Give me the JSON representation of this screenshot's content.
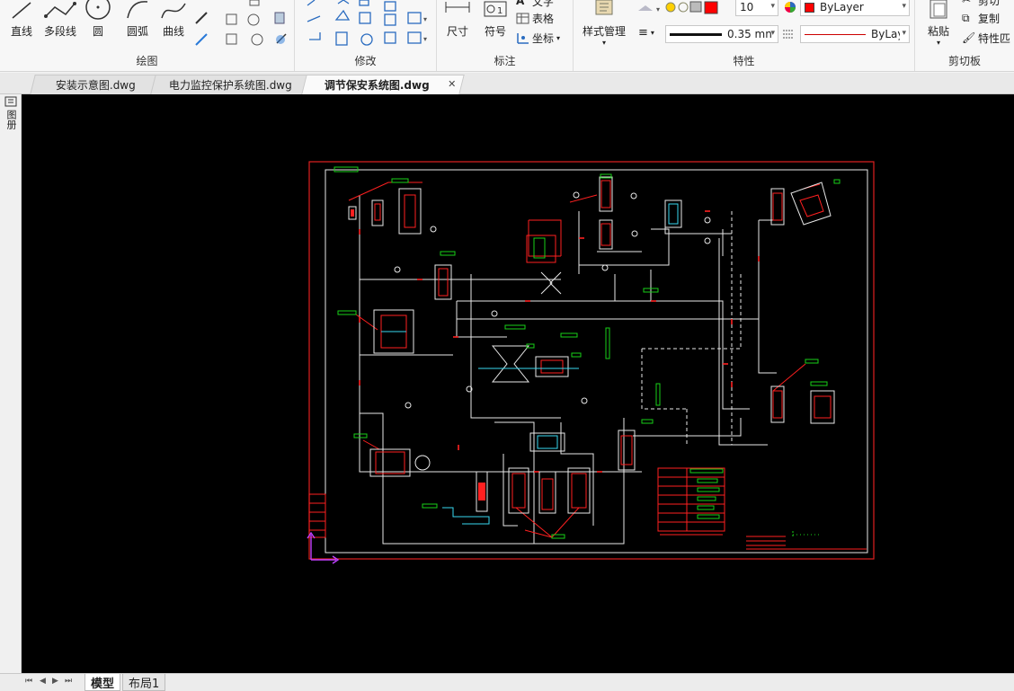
{
  "ribbon": {
    "draw": {
      "title": "绘图",
      "line": "直线",
      "polyline": "多段线",
      "circle": "圆",
      "arc": "圆弧",
      "curve": "曲线"
    },
    "modify": {
      "title": "修改"
    },
    "annotate": {
      "title": "标注",
      "dimension": "尺寸",
      "symbol": "符号",
      "text": "文字",
      "table": "表格",
      "coordinate": "坐标"
    },
    "properties": {
      "title": "特性",
      "style_manager": "样式管理",
      "color_index": "10",
      "layer_color": "ByLayer",
      "lineweight": "0.35 mn",
      "linetype": "ByLayer",
      "colors": {
        "red": "#ff0000",
        "linetype_red": "#cc0000"
      }
    },
    "clipboard": {
      "title": "剪切板",
      "paste": "粘贴",
      "cut": "剪切",
      "copy": "复制",
      "match": "特性匹"
    }
  },
  "tabs": [
    {
      "label": "安装示意图.dwg"
    },
    {
      "label": "电力监控保护系统图.dwg"
    },
    {
      "label": "调节保安系统图.dwg",
      "active": true
    }
  ],
  "left_strip": {
    "label": "图册"
  },
  "layouts": [
    {
      "label": "模型",
      "active": true
    },
    {
      "label": "布局1"
    }
  ],
  "canvas": {
    "background": "#000000",
    "border_color": "#ff2020"
  }
}
